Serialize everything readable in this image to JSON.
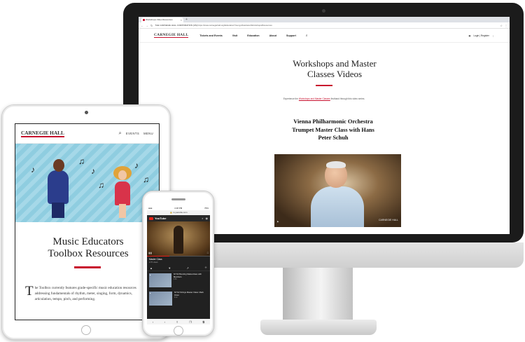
{
  "desktop": {
    "tab_title": "Workshops Video Resources",
    "address": "https://www.carnegiehall.org/Education/Young-Musicians/Workshops/Resources",
    "secure_label": "THE CARNEGIE HALL CORPORATION [US]",
    "logo": "CARNEGIE HALL",
    "nav": [
      "Tickets and Events",
      "Visit",
      "Education",
      "About",
      "Support"
    ],
    "account": "Login | Register",
    "page_title": "Workshops and Master Classes Videos",
    "intro_before": "Experience the ",
    "intro_link": "Workshops and Master Classes",
    "intro_after": " firsthand through this video series.",
    "video_title": "Vienna Philharmonic Orchestra Trumpet Master Class with Hans Peter Schuh",
    "video_overlay_right": "CARNEGIE HALL"
  },
  "tablet": {
    "logo": "CARNEGIE HALL",
    "nav": [
      "EVENTS",
      "MENU"
    ],
    "title": "Music Educators Toolbox Resources",
    "dropcap": "T",
    "body": "he Toolbox currently features grade-specific music education resources addressing fundamentals of rhythm, meter, singing, form, dynamics, articulation, tempo, pitch, and performing."
  },
  "phone": {
    "status_time": "4:18 PM",
    "status_battery": "76%",
    "url": "m.youtube.com",
    "app_name": "YouTube",
    "video_progress": 0.35,
    "video_title": "Master Class",
    "video_meta": "2.7K views",
    "list": [
      {
        "title": "NYO2 Bonding Masterclass with Members",
        "meta": "4:50"
      },
      {
        "title": "NYO2 Strings Master Class: Mark Orton",
        "meta": "6:12"
      }
    ]
  },
  "colors": {
    "brand_red": "#c8102e",
    "youtube_red": "#e62117"
  }
}
